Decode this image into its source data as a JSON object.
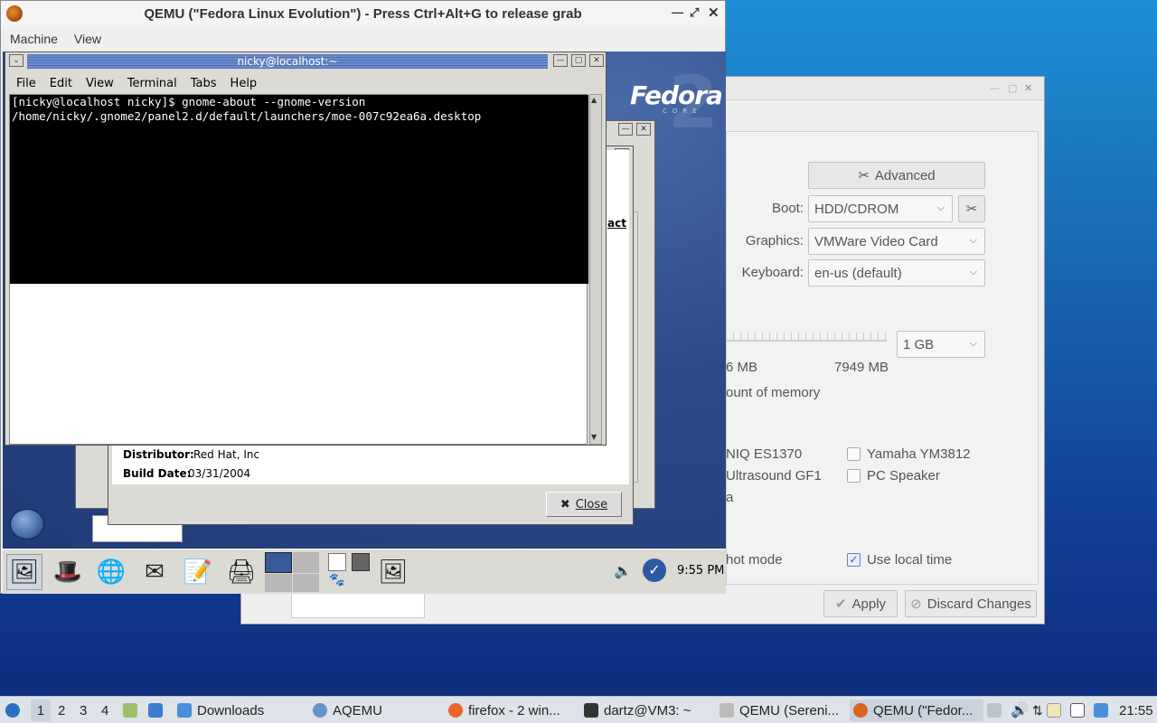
{
  "host_settings": {
    "advanced_button": "Advanced",
    "boot_label": "Boot:",
    "boot_value": "HDD/CDROM",
    "graphics_label": "Graphics:",
    "graphics_value": "VMWare Video Card",
    "keyboard_label": "Keyboard:",
    "keyboard_value": "en-us (default)",
    "memory_value": "1 GB",
    "memory_min": "6 MB",
    "memory_max": "7949 MB",
    "memory_caption": "ount of memory",
    "audio_left": [
      "NIQ ES1370",
      "Ultrasound GF1",
      "a"
    ],
    "audio_right": [
      "Yamaha YM3812",
      "PC Speaker"
    ],
    "snapshot_label": "hot mode",
    "use_local_time": "Use local time",
    "apply_button": "Apply",
    "discard_button": "Discard Changes"
  },
  "qemu": {
    "title": "QEMU (\"Fedora Linux Evolution\") - Press Ctrl+Alt+G to release grab",
    "menu": [
      "Machine",
      "View"
    ]
  },
  "guest": {
    "terminal": {
      "title": "nicky@localhost:~",
      "menu": [
        "File",
        "Edit",
        "View",
        "Terminal",
        "Tabs",
        "Help"
      ],
      "lines": [
        "[nicky@localhost nicky]$ gnome-about --gnome-version",
        "/home/nicky/.gnome2/panel2.d/default/launchers/moe-007c92ea6a.desktop"
      ]
    },
    "about": {
      "link_fragment": "act",
      "distributor_label": "Distributor:",
      "distributor_value": "Red Hat, Inc",
      "build_label": "Build Date:",
      "build_value": "03/31/2004",
      "close_button": "Close"
    },
    "logo": "Fedora",
    "logo_sub": "CORE",
    "clock": "9:55 PM"
  },
  "taskbar": {
    "workspaces": [
      "1",
      "2",
      "3",
      "4"
    ],
    "items": [
      "Downloads",
      "AQEMU",
      "firefox - 2 win...",
      "dartz@VM3: ~",
      "QEMU (Sereni...",
      "QEMU (\"Fedor..."
    ],
    "clock": "21:55"
  }
}
